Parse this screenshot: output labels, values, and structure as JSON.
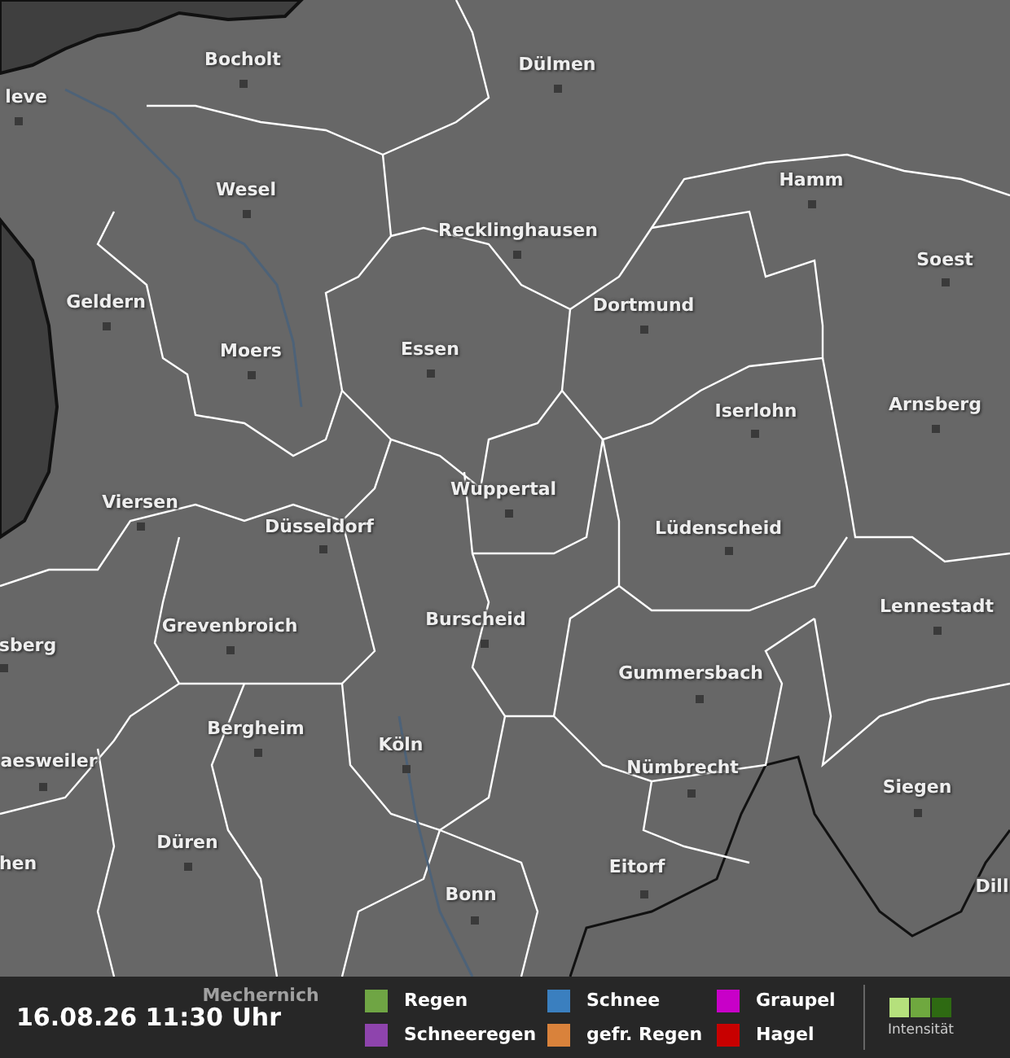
{
  "map": {
    "cities": [
      {
        "name": "Bocholt"
      },
      {
        "name": "leve"
      },
      {
        "name": "Dülmen"
      },
      {
        "name": "Wesel"
      },
      {
        "name": "Recklinghausen"
      },
      {
        "name": "Hamm"
      },
      {
        "name": "Soest"
      },
      {
        "name": "Geldern"
      },
      {
        "name": "Dortmund"
      },
      {
        "name": "Moers"
      },
      {
        "name": "Essen"
      },
      {
        "name": "Arnsberg"
      },
      {
        "name": "Iserlohn"
      },
      {
        "name": "Viersen"
      },
      {
        "name": "Wuppertal"
      },
      {
        "name": "Düsseldorf"
      },
      {
        "name": "Lüdenscheid"
      },
      {
        "name": "Grevenbroich"
      },
      {
        "name": "Lennestadt"
      },
      {
        "name": "Burscheid"
      },
      {
        "name": "sberg"
      },
      {
        "name": "Gummersbach"
      },
      {
        "name": "Bergheim"
      },
      {
        "name": "Köln"
      },
      {
        "name": "aesweiler"
      },
      {
        "name": "Nümbrecht"
      },
      {
        "name": "Siegen"
      },
      {
        "name": "hen"
      },
      {
        "name": "Düren"
      },
      {
        "name": "Eitorf"
      },
      {
        "name": "Bonn"
      },
      {
        "name": "Dill"
      },
      {
        "name": "Mechernich"
      }
    ]
  },
  "footer": {
    "timestamp": "16.08.26 11:30 Uhr",
    "legend": [
      {
        "label": "Regen",
        "color": "#6fa544"
      },
      {
        "label": "Schneeregen",
        "color": "#8e44ad"
      },
      {
        "label": "Schnee",
        "color": "#3a7fbf"
      },
      {
        "label": "gefr. Regen",
        "color": "#d9823b"
      },
      {
        "label": "Graupel",
        "color": "#c800c8"
      },
      {
        "label": "Hagel",
        "color": "#c80000"
      }
    ],
    "intensity": {
      "label": "Intensität",
      "steps": [
        {
          "color": "#b5e07c"
        },
        {
          "color": "#6fa83f"
        },
        {
          "color": "#2e6a12"
        }
      ]
    }
  }
}
